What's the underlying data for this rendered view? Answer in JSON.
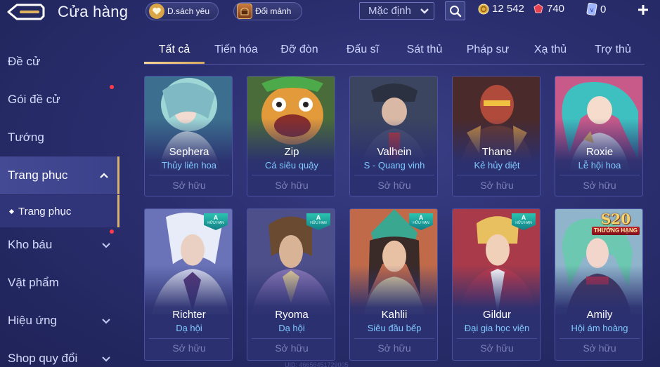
{
  "header": {
    "title": "Cửa hàng",
    "wishlist_label": "D.sách yêu",
    "shards_label": "Đổi mảnh",
    "sort_selected": "Mặc định"
  },
  "currency": {
    "gold": "12 542",
    "ruby": "740",
    "voucher": "0"
  },
  "sidebar": {
    "items": [
      {
        "label": "Đề cử"
      },
      {
        "label": "Gói đề cử"
      },
      {
        "label": "Tướng"
      },
      {
        "label": "Trang phục"
      },
      {
        "label": "Kho báu"
      },
      {
        "label": "Vật phẩm"
      },
      {
        "label": "Hiệu ứng"
      },
      {
        "label": "Shop quy đổi"
      }
    ],
    "sub_item": "Trang phục"
  },
  "tabs": [
    "Tất cả",
    "Tiến hóa",
    "Đỡ đòn",
    "Đấu sĩ",
    "Sát thủ",
    "Pháp sư",
    "Xạ thủ",
    "Trợ thủ"
  ],
  "cards": [
    {
      "hero": "Sephera",
      "skin": "Thủy liên hoa",
      "status": "Sở hữu"
    },
    {
      "hero": "Zip",
      "skin": "Cá siêu quậy",
      "status": "Sở hữu"
    },
    {
      "hero": "Valhein",
      "skin": "S - Quang vinh",
      "status": "Sở hữu"
    },
    {
      "hero": "Thane",
      "skin": "Kẻ hủy diệt",
      "status": "Sở hữu"
    },
    {
      "hero": "Roxie",
      "skin": "Lễ hội hoa",
      "status": "Sở hữu"
    },
    {
      "hero": "Richter",
      "skin": "Dạ hội",
      "status": "Sở hữu"
    },
    {
      "hero": "Ryoma",
      "skin": "Dạ hội",
      "status": "Sở hữu"
    },
    {
      "hero": "Kahlii",
      "skin": "Siêu đầu bếp",
      "status": "Sở hữu"
    },
    {
      "hero": "Gildur",
      "skin": "Đại gia học viện",
      "status": "Sở hữu"
    },
    {
      "hero": "Amily",
      "skin": "Hội ám hoàng",
      "status": "Sở hữu"
    }
  ],
  "badges": {
    "tier_letter": "A",
    "tier_text": "HỮU HẠN",
    "season": "S20",
    "season_text": "THƯỞNG HẠNG"
  },
  "footer": {
    "uid": "UID: 46656451729005"
  }
}
